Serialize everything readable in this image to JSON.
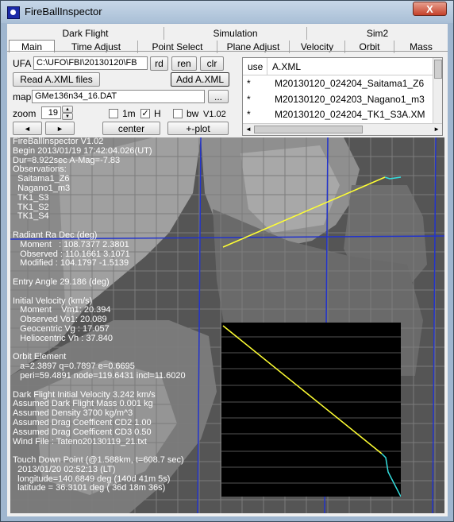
{
  "window": {
    "title": "FireBallInspector",
    "close_label": "X"
  },
  "tabs_row1": [
    "Dark Flight",
    "Simulation",
    "Sim2"
  ],
  "tabs_row2": [
    "Main",
    "Time Adjust",
    "Point Select",
    "Plane Adjust",
    "Velocity",
    "Orbit",
    "Mass"
  ],
  "ufa": {
    "label": "UFA",
    "path": "C:\\UFO\\FBI\\20130120\\FB",
    "rd": "rd",
    "ren": "ren",
    "clr": "clr"
  },
  "buttons": {
    "read_axml": "Read A.XML files",
    "add_axml": "Add A.XML",
    "browse": "...",
    "center": "center",
    "plot": "+-plot",
    "left": "◄",
    "right": "►"
  },
  "map_field": {
    "label": "map",
    "value": "GMe136n34_16.DAT"
  },
  "zoom": {
    "label": "zoom",
    "value": "19"
  },
  "checks": {
    "one_m": "1m",
    "h": "H",
    "bw": "bw",
    "version": "V1.02",
    "h_checked": "✓"
  },
  "list": {
    "col_use": "use",
    "col_axml": "A.XML",
    "rows": [
      {
        "use": "*",
        "file": "M20130120_024204_Saitama1_Z6"
      },
      {
        "use": "*",
        "file": "M20130120_024203_Nagano1_m3"
      },
      {
        "use": "*",
        "file": "M20130120_024204_TK1_S3A.XM"
      }
    ]
  },
  "info_text": "FireBallInspector V1.02\nBegin 2013/01/19 17:42:04.026(UT)\nDur=8.922sec A-Mag=-7.83\nObservations:\n  Saitama1_Z6\n  Nagano1_m3\n  TK1_S3\n  TK1_S2\n  TK1_S4\n\nRadiant Ra Dec (deg)\n   Moment   : 108.7377 2.3801\n   Observed : 110.1661 3.1071\n   Modified : 104.1797 -1.5139\n\nEntry Angle 29.186 (deg)\n\nInitial Velocity (km/s)\n   Moment    Vm1: 20.394\n   Observed Vo1: 20.089\n   Geocentric Vg : 17.057\n   Heliocentric Vh : 37.840\n\nOrbit Element\n   a=2.3897 q=0.7897 e=0.6695\n   peri=59.4891 node=119.6431 incl=11.6020\n\nDark Flight Initial Velocity 3.242 km/s\nAssumed Dark Flight Mass 0.001 kg\nAssumed Density 3700 kg/m^3\nAssumed Drag Coefficent CD2 1.00\nAssumed Drag Coefficent CD3 0.50\nWind File : Tateno20130119_21.txt\n\nTouch Down Point (@1.588km, t=608.7 sec)\n  2013/01/20 02:52:13 (LT)\n  longitude=140.6849 deg (140d 41m 5s)\n  latitude = 36.3101 deg ( 36d 18m 36s)",
  "colors": {
    "track": "#ffff33",
    "dark_flight": "#33dddd",
    "grid": "#2233cc"
  }
}
